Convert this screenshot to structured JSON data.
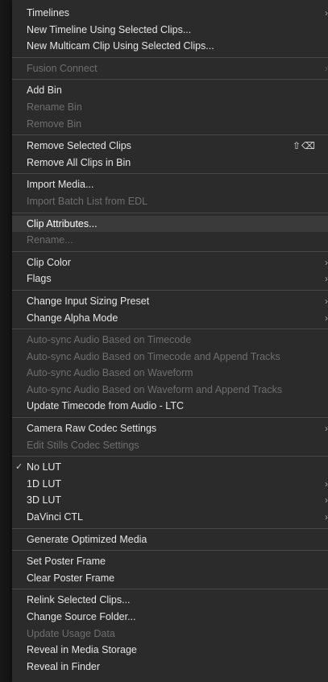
{
  "menu": {
    "groups": [
      [
        {
          "label": "Timelines",
          "submenu": true
        },
        {
          "label": "New Timeline Using Selected Clips..."
        },
        {
          "label": "New Multicam Clip Using Selected Clips..."
        }
      ],
      [
        {
          "label": "Fusion Connect",
          "disabled": true,
          "submenu": true
        }
      ],
      [
        {
          "label": "Add Bin"
        },
        {
          "label": "Rename Bin",
          "disabled": true
        },
        {
          "label": "Remove Bin",
          "disabled": true
        }
      ],
      [
        {
          "label": "Remove Selected Clips",
          "shortcut": "⇧⌫"
        },
        {
          "label": "Remove All Clips in Bin"
        }
      ],
      [
        {
          "label": "Import Media..."
        },
        {
          "label": "Import Batch List from EDL",
          "disabled": true
        }
      ],
      [
        {
          "label": "Clip Attributes...",
          "highlighted": true
        },
        {
          "label": "Rename...",
          "disabled": true
        }
      ],
      [
        {
          "label": "Clip Color",
          "submenu": true
        },
        {
          "label": "Flags",
          "submenu": true
        }
      ],
      [
        {
          "label": "Change Input Sizing Preset",
          "submenu": true
        },
        {
          "label": "Change Alpha Mode",
          "submenu": true
        }
      ],
      [
        {
          "label": "Auto-sync Audio Based on Timecode",
          "disabled": true
        },
        {
          "label": "Auto-sync Audio Based on Timecode and Append Tracks",
          "disabled": true
        },
        {
          "label": "Auto-sync Audio Based on Waveform",
          "disabled": true
        },
        {
          "label": "Auto-sync Audio Based on Waveform and Append Tracks",
          "disabled": true
        },
        {
          "label": "Update Timecode from Audio - LTC"
        }
      ],
      [
        {
          "label": "Camera Raw Codec Settings",
          "submenu": true
        },
        {
          "label": "Edit Stills Codec Settings",
          "disabled": true
        }
      ],
      [
        {
          "label": "No LUT",
          "checked": true
        },
        {
          "label": "1D LUT",
          "submenu": true
        },
        {
          "label": "3D LUT",
          "submenu": true
        },
        {
          "label": "DaVinci CTL",
          "submenu": true
        }
      ],
      [
        {
          "label": "Generate Optimized Media"
        }
      ],
      [
        {
          "label": "Set Poster Frame"
        },
        {
          "label": "Clear Poster Frame"
        }
      ],
      [
        {
          "label": "Relink Selected Clips..."
        },
        {
          "label": "Change Source Folder..."
        },
        {
          "label": "Update Usage Data",
          "disabled": true
        },
        {
          "label": "Reveal in Media Storage"
        },
        {
          "label": "Reveal in Finder"
        }
      ]
    ],
    "icons": {
      "submenu": "›",
      "check": "✓"
    },
    "colors": {
      "background": "#2b2b2b",
      "text": "#e6e6e6",
      "disabled_text": "#6e6e6e",
      "highlight": "#3a3a3a",
      "separator": "#474747"
    }
  }
}
